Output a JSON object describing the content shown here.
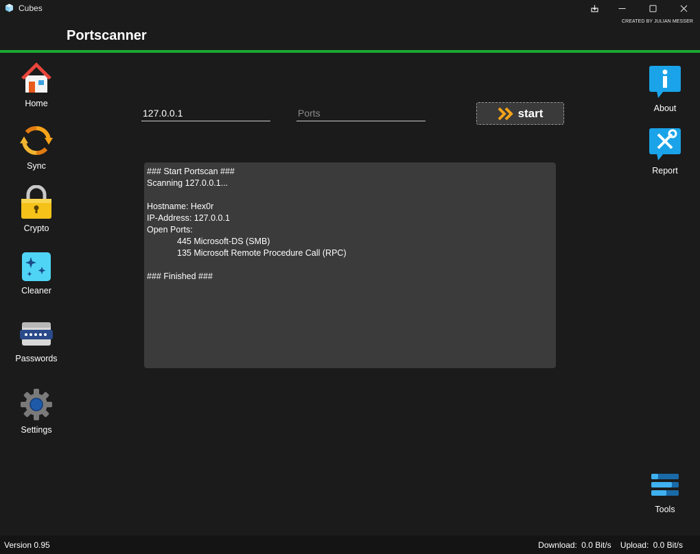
{
  "window": {
    "title": "Cubes",
    "credit": "CREATED BY JULIAN MESSER"
  },
  "header": {
    "title": "Portscanner"
  },
  "sidebar_left": {
    "items": [
      {
        "label": "Home",
        "icon": "home-icon"
      },
      {
        "label": "Sync",
        "icon": "sync-icon"
      },
      {
        "label": "Crypto",
        "icon": "lock-icon"
      },
      {
        "label": "Cleaner",
        "icon": "sparkle-icon"
      },
      {
        "label": "Passwords",
        "icon": "password-icon"
      },
      {
        "label": "Settings",
        "icon": "gear-icon"
      }
    ]
  },
  "sidebar_right": {
    "items": [
      {
        "label": "About",
        "icon": "info-icon"
      },
      {
        "label": "Report",
        "icon": "wrench-icon"
      },
      {
        "label": "Tools",
        "icon": "tools-icon"
      }
    ]
  },
  "scanner": {
    "ip_value": "127.0.0.1",
    "ports_placeholder": "Ports",
    "start_label": "start",
    "output": [
      {
        "text": "### Start Portscan ###",
        "indent": false
      },
      {
        "text": "Scanning 127.0.0.1...",
        "indent": false
      },
      {
        "text": "",
        "indent": false
      },
      {
        "text": "Hostname: Hex0r",
        "indent": false
      },
      {
        "text": "IP-Address: 127.0.0.1",
        "indent": false
      },
      {
        "text": "Open Ports:",
        "indent": false
      },
      {
        "text": "445 Microsoft-DS (SMB)",
        "indent": true
      },
      {
        "text": "135 Microsoft Remote Procedure Call (RPC)",
        "indent": true
      },
      {
        "text": "",
        "indent": false
      },
      {
        "text": "### Finished ###",
        "indent": false
      }
    ]
  },
  "status": {
    "version": "Version 0.95",
    "download_label": "Download:",
    "download_value": "0.0 Bit/s",
    "upload_label": "Upload:",
    "upload_value": "0.0 Bit/s"
  },
  "colors": {
    "accent": "#1aa730",
    "background": "#1b1b1b",
    "output_bg": "#3b3b3b"
  }
}
